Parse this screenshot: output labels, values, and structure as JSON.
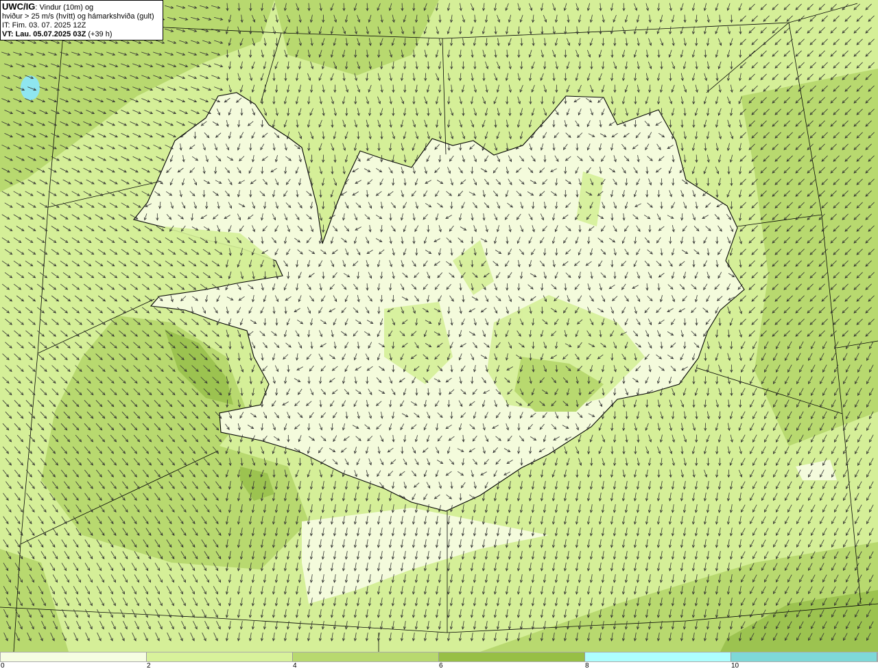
{
  "title": {
    "model": "UWC/IG",
    "line1_rest": ": Vindur (10m) og",
    "line2": "hviður > 25 m/s (hvítt) og hámarkshviða (gult)",
    "line3": "IT: Fim. 03. 07. 2025 12Z",
    "line4_bold": "VT: Lau. 05.07.2025 03Z",
    "line4_rest": " (+39 h)"
  },
  "legend": {
    "colors": [
      "#f6fde2",
      "#d8f29b",
      "#b8d96f",
      "#97bf45",
      "#adfefe",
      "#7ed8d8"
    ],
    "ticks": [
      "0",
      "2",
      "4",
      "6",
      "8",
      "10"
    ]
  },
  "map": {
    "land_color": "#f4fbdc",
    "sea_color": "#d5ef98",
    "medium_color": "#b8d96f",
    "dark_color": "#9cc350",
    "arrow_color": "#333333",
    "coast_color": "#000000",
    "lake_color": "#8fe6f0"
  }
}
